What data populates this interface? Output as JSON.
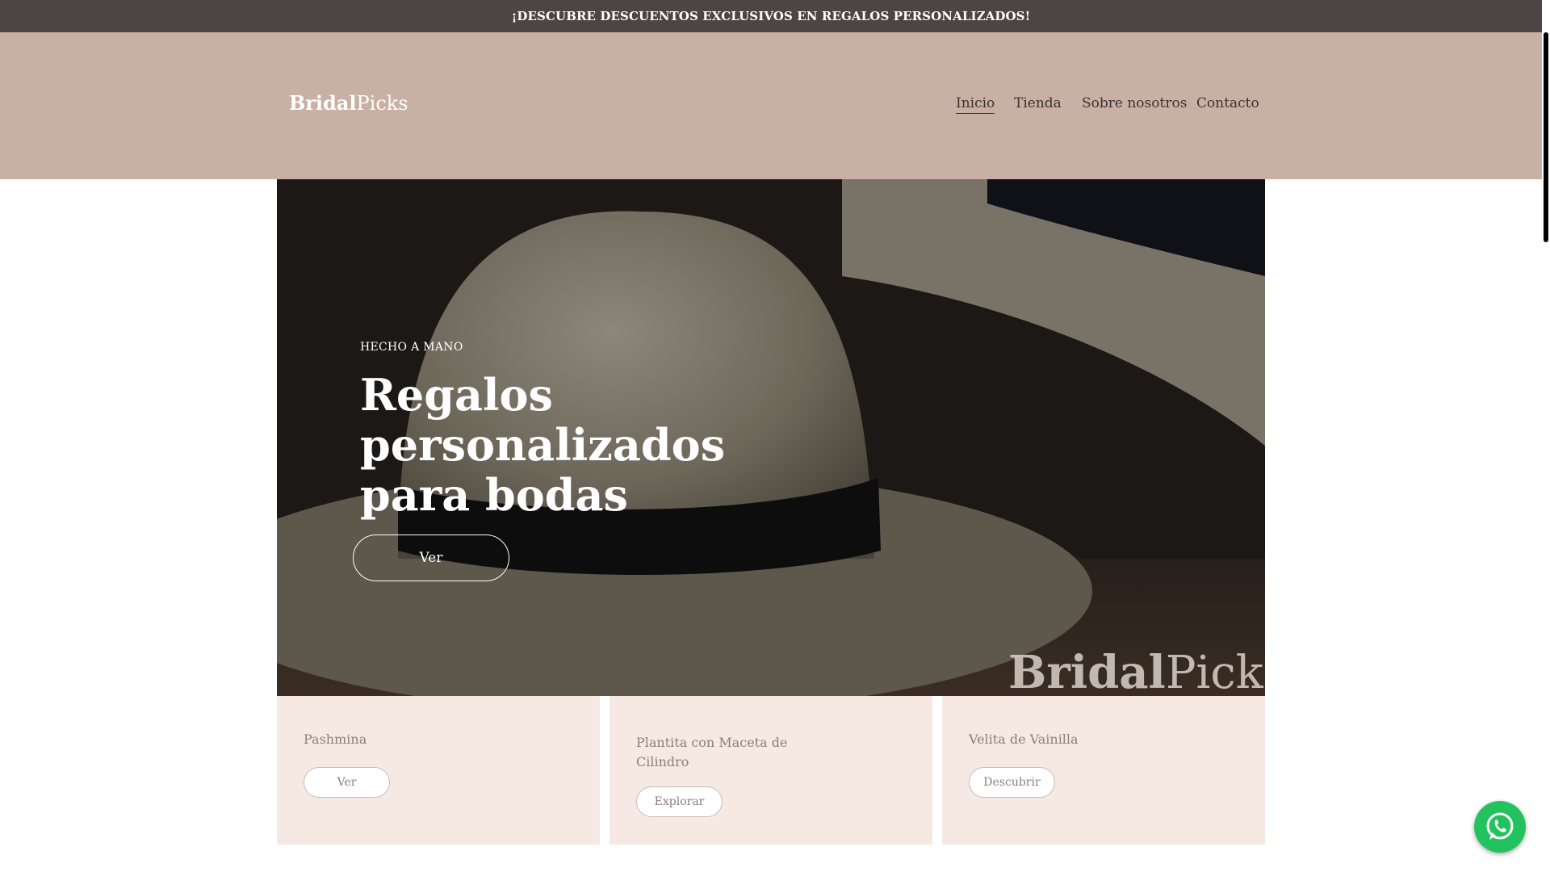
{
  "promo": {
    "text": "¡DESCUBRE DESCUENTOS EXCLUSIVOS EN REGALOS PERSONALIZADOS!"
  },
  "header": {
    "logo_bold": "Bridal",
    "logo_light": "Picks",
    "nav": [
      {
        "label": "Inicio",
        "active": true
      },
      {
        "label": "Tienda"
      },
      {
        "label": "Sobre nosotros"
      },
      {
        "label": "Contacto"
      }
    ]
  },
  "hero": {
    "eyebrow": "HECHO A MANO",
    "title": "Regalos personalizados para bodas",
    "button": "Ver",
    "watermark_bold": "Bridal",
    "watermark_light": "Picks"
  },
  "cards": [
    {
      "title": "Pashmina",
      "button": "Ver"
    },
    {
      "title": "Plantita con Maceta de Cilindro",
      "button": "Explorar"
    },
    {
      "title": "Velita de Vainilla",
      "button": "Descubrir"
    }
  ],
  "floating": {
    "icon": "whatsapp-icon",
    "color": "#22c35e"
  },
  "colors": {
    "promo_bg": "#4d4544",
    "header_bg": "#c8b0a4",
    "card_bg": "#f6e9e3"
  }
}
